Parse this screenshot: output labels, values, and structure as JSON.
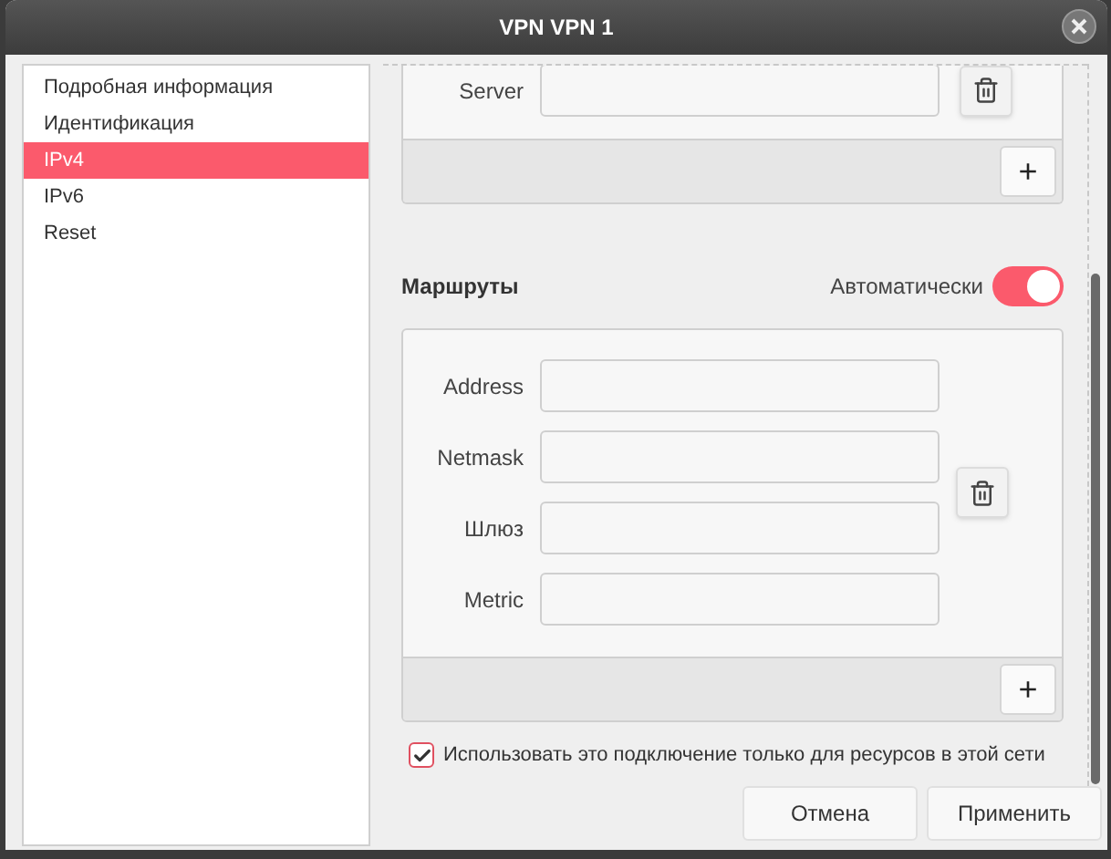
{
  "window": {
    "title": "VPN VPN 1"
  },
  "sidebar": {
    "items": [
      {
        "label": "Подробная информация",
        "selected": false
      },
      {
        "label": "Идентификация",
        "selected": false
      },
      {
        "label": "IPv4",
        "selected": true
      },
      {
        "label": "IPv6",
        "selected": false
      },
      {
        "label": "Reset",
        "selected": false
      }
    ]
  },
  "dns": {
    "fields": [
      {
        "label": "Server"
      }
    ],
    "add_button": "+"
  },
  "routes": {
    "title": "Маршруты",
    "auto_label": "Автоматически",
    "auto_on": true,
    "fields": [
      {
        "label": "Address"
      },
      {
        "label": "Netmask"
      },
      {
        "label": "Шлюз"
      },
      {
        "label": "Metric"
      }
    ],
    "add_button": "+"
  },
  "restrict": {
    "label": "Использовать это подключение только для ресурсов в этой сети",
    "checked": true
  },
  "buttons": [
    "Отмена",
    "Применить"
  ]
}
